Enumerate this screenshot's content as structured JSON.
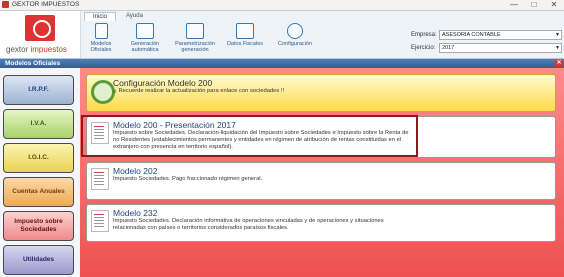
{
  "window": {
    "title": "GEXTOR IMPUESTOS",
    "controls": [
      "—",
      "□",
      "✕"
    ]
  },
  "logo": {
    "name_part1": "gextor",
    "name_part2": " impuestos"
  },
  "ribbon": {
    "tabs": [
      {
        "label": "Inicio"
      },
      {
        "label": "Ayuda"
      }
    ],
    "tools": [
      {
        "label": "Modelos Oficiales",
        "icon": "document-icon"
      },
      {
        "label": "Generación automática",
        "icon": "generate-icon"
      },
      {
        "label": "Parametrización generación",
        "icon": "folder-settings-icon"
      },
      {
        "label": "Datos Fiscales",
        "icon": "monitor-icon"
      },
      {
        "label": "Configuración",
        "icon": "gear-icon"
      }
    ]
  },
  "selectors": {
    "empresa_label": "Empresa:",
    "empresa_value": "ASESORIA CONTABLE",
    "ejercicio_label": "Ejercicio:",
    "ejercicio_value": "2017"
  },
  "panel": {
    "title": "Modelos Oficiales",
    "close": "✕"
  },
  "categories": [
    {
      "label": "I.R.P.F."
    },
    {
      "label": "I.V.A."
    },
    {
      "label": "I.G.I.C."
    },
    {
      "label": "Cuentas Anuales"
    },
    {
      "label": "Impuesto sobre Sociedades"
    },
    {
      "label": "Utilidades"
    }
  ],
  "cards": [
    {
      "title": "Configuración Modelo 200",
      "desc": "¡¡ Recuerde realizar la actualización para enlace con sociedades !!"
    },
    {
      "title": "Modelo 200 - Presentación 2017",
      "desc": "Impuesto sobre Sociedades. Declaración-liquidación del Impuesto sobre Sociedades e Impuesto sobre la Renta de no Residentes (establecimientos permanentes y entidades en régimen de atribución de rentas constituidas en el extranjero con presencia en territorio español)."
    },
    {
      "title": "Modelo 202",
      "desc": "Impuesto Sociedades. Pago fraccionado régimen general."
    },
    {
      "title": "Modelo 232",
      "desc": "Impuesto Sociedades. Declaración informativa de operaciones vinculadas y de operaciones y situaciones relacionadas con países o territorios considerados paraísos fiscales."
    }
  ]
}
